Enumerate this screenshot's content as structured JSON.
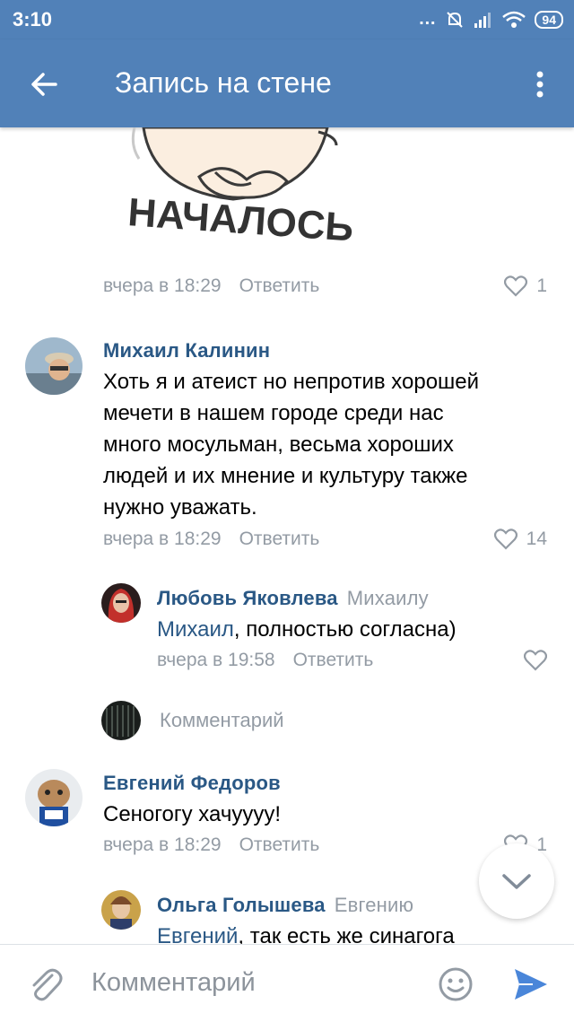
{
  "status": {
    "time": "3:10",
    "battery": "94"
  },
  "appbar": {
    "title": "Запись на стене"
  },
  "sticker": {
    "caption": "НАЧАЛОСЬ"
  },
  "first_meta": {
    "time": "вчера в 18:29",
    "reply": "Ответить",
    "likes": "1"
  },
  "comments": [
    {
      "author": "Михаил Калинин",
      "text_lines": [
        "Хоть я и атеист но непротив хорошей",
        "мечети в нашем городе среди нас",
        "много мосульман, весьма хороших",
        "людей и их мнение и культуру также",
        "нужно уважать."
      ],
      "time": "вчера в 18:29",
      "reply": "Ответить",
      "likes": "14"
    },
    {
      "author": "Любовь Яковлева",
      "to": "Михаилу",
      "mention": "Михаил",
      "text": ", полностью согласна)",
      "time": "вчера в 19:58",
      "reply": "Ответить"
    },
    {
      "author": "Евгений Федоров",
      "text": "Сеногогу хачуууу!",
      "time": "вчера в 18:29",
      "reply": "Ответить",
      "likes": "1"
    },
    {
      "author": "Ольга Голышева",
      "to": "Евгению",
      "mention": "Евгений",
      "text": ", так есть же синагога"
    }
  ],
  "reply_field": {
    "placeholder": "Комментарий"
  },
  "composer": {
    "placeholder": "Комментарий"
  },
  "icons": {
    "back": "arrow-left-icon",
    "more": "more-vertical-icon",
    "like": "heart-icon",
    "attach": "paperclip-icon",
    "emoji": "smile-icon",
    "send": "send-icon",
    "scroll": "chevron-down-icon"
  },
  "colors": {
    "header": "#5181b8",
    "link": "#2a5885",
    "meta": "#939ba4",
    "send": "#4a86d9"
  }
}
